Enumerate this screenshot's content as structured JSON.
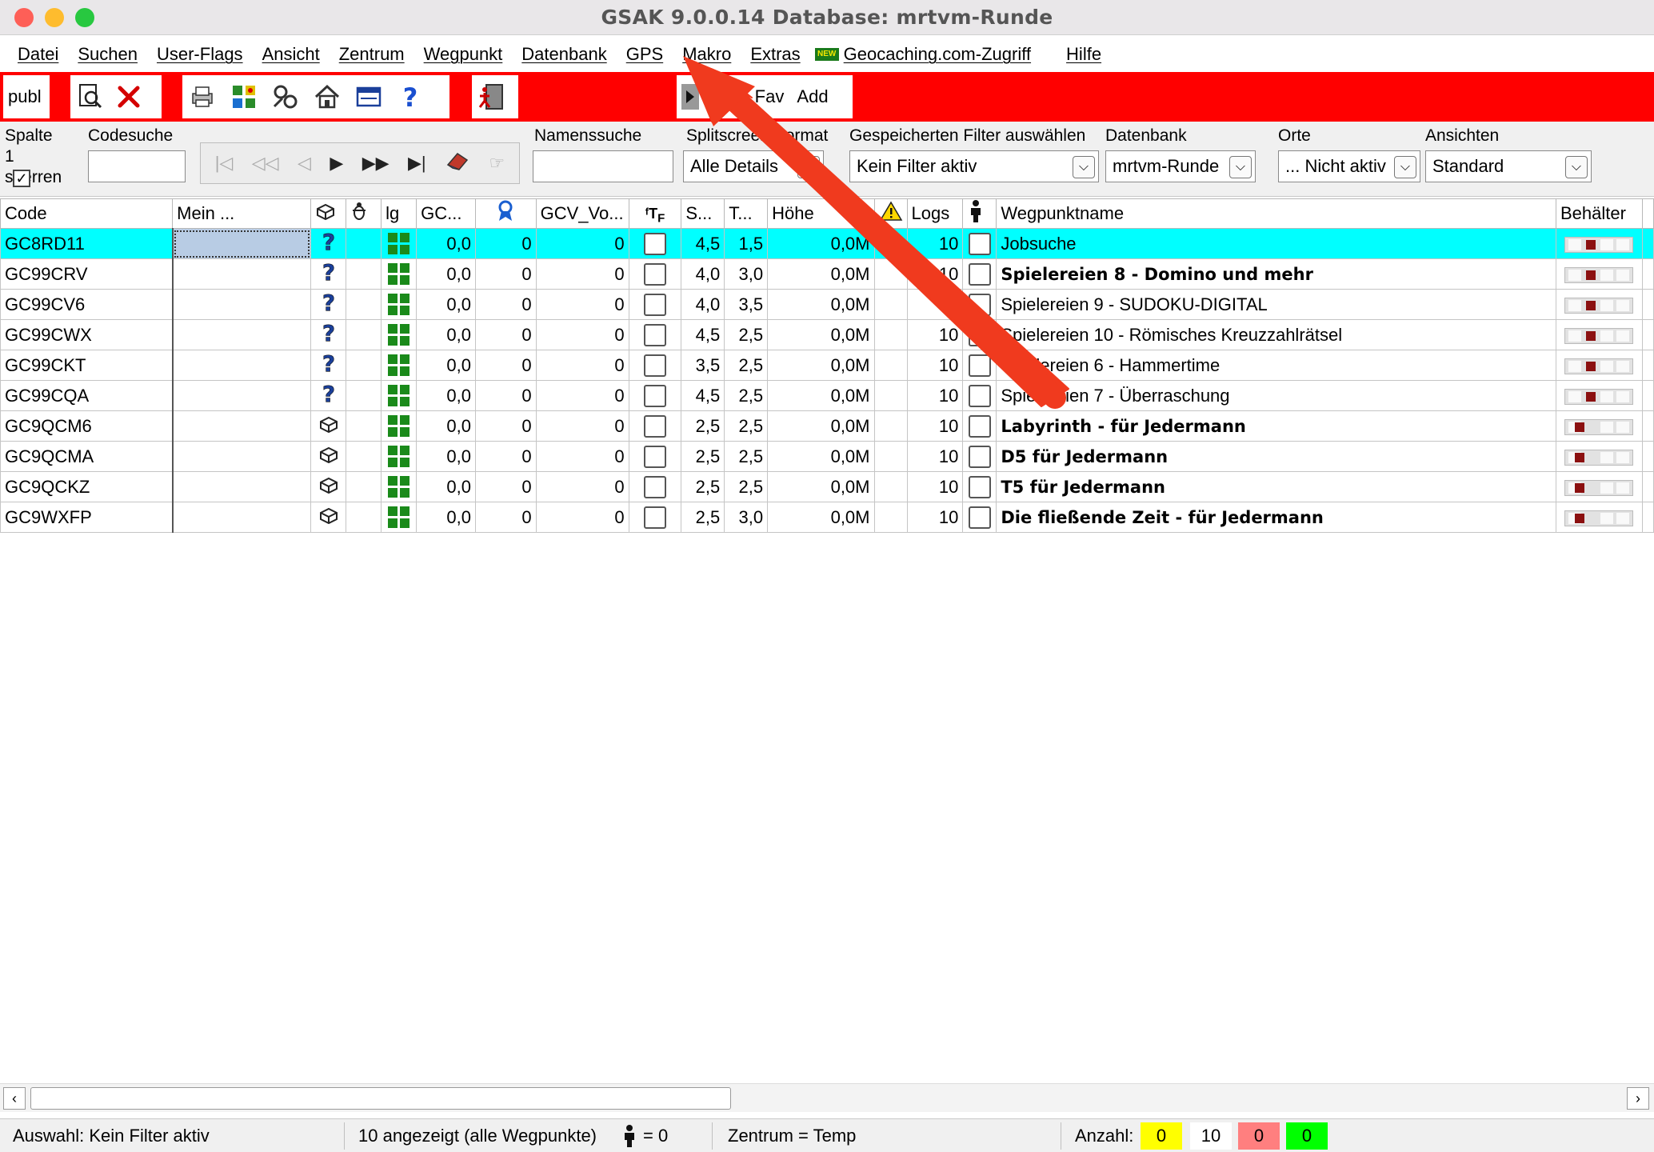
{
  "window": {
    "title": "GSAK 9.0.0.14    Database: mrtvm-Runde"
  },
  "menu": {
    "items": [
      "Datei",
      "Suchen",
      "User-Flags",
      "Ansicht",
      "Zentrum",
      "Wegpunkt",
      "Datenbank",
      "GPS",
      "Makro",
      "Extras"
    ],
    "new_badge": "NEW",
    "geocaching": "Geocaching.com-Zugriff",
    "help": "Hilfe"
  },
  "toolbar": {
    "publ_label": "publ",
    "macro_fi": "Fi",
    "macro_fav": "Fav",
    "macro_add": "Add"
  },
  "filters": {
    "spalte_label": "Spalte",
    "spalte_value": "1",
    "sperren_label": "sperren",
    "codesuche_label": "Codesuche",
    "codesuche_value": "",
    "namenssuche_label": "Namenssuche",
    "namenssuche_value": "",
    "splitscreen_label": "Splitscreen-Format",
    "splitscreen_value": "Alle Details",
    "filter_label": "Gespeicherten Filter auswählen",
    "filter_value": "Kein Filter aktiv",
    "datenbank_label": "Datenbank",
    "datenbank_value": "mrtvm-Runde",
    "orte_label": "Orte",
    "orte_value": "... Nicht aktiv",
    "ansichten_label": "Ansichten",
    "ansichten_value": "Standard"
  },
  "grid": {
    "headers": {
      "code": "Code",
      "mein": "Mein ...",
      "ig": "lg",
      "gc": "GC...",
      "gcv": "GCV_Vo...",
      "s": "S...",
      "t": "T...",
      "hoehe": "Höhe",
      "logs": "Logs",
      "name": "Wegpunktname",
      "behaelter": "Behälter"
    },
    "rows": [
      {
        "code": "GC8RD11",
        "type": "mystery",
        "gc": "0,0",
        "fav": "0",
        "gcv": "0",
        "s": "4,5",
        "t": "1,5",
        "hoehe": "0,0M",
        "logs": "10",
        "name": "Jobsuche",
        "bold": false,
        "selected": true
      },
      {
        "code": "GC99CRV",
        "type": "mystery",
        "gc": "0,0",
        "fav": "0",
        "gcv": "0",
        "s": "4,0",
        "t": "3,0",
        "hoehe": "0,0M",
        "logs": "10",
        "name": "Spielereien 8 - Domino und mehr",
        "bold": true,
        "selected": false
      },
      {
        "code": "GC99CV6",
        "type": "mystery",
        "gc": "0,0",
        "fav": "0",
        "gcv": "0",
        "s": "4,0",
        "t": "3,5",
        "hoehe": "0,0M",
        "logs": "10",
        "name": "Spielereien 9 - SUDOKU-DIGITAL",
        "bold": false,
        "selected": false
      },
      {
        "code": "GC99CWX",
        "type": "mystery",
        "gc": "0,0",
        "fav": "0",
        "gcv": "0",
        "s": "4,5",
        "t": "2,5",
        "hoehe": "0,0M",
        "logs": "10",
        "name": "Spielereien 10 - Römisches Kreuzzahlrätsel",
        "bold": false,
        "selected": false
      },
      {
        "code": "GC99CKT",
        "type": "mystery",
        "gc": "0,0",
        "fav": "0",
        "gcv": "0",
        "s": "3,5",
        "t": "2,5",
        "hoehe": "0,0M",
        "logs": "10",
        "name": "Spielereien 6 - Hammertime",
        "bold": false,
        "selected": false
      },
      {
        "code": "GC99CQA",
        "type": "mystery",
        "gc": "0,0",
        "fav": "0",
        "gcv": "0",
        "s": "4,5",
        "t": "2,5",
        "hoehe": "0,0M",
        "logs": "10",
        "name": "Spielereien 7 - Überraschung",
        "bold": false,
        "selected": false
      },
      {
        "code": "GC9QCM6",
        "type": "multi",
        "gc": "0,0",
        "fav": "0",
        "gcv": "0",
        "s": "2,5",
        "t": "2,5",
        "hoehe": "0,0M",
        "logs": "10",
        "name": "Labyrinth - für Jedermann",
        "bold": true,
        "selected": false
      },
      {
        "code": "GC9QCMA",
        "type": "multi",
        "gc": "0,0",
        "fav": "0",
        "gcv": "0",
        "s": "2,5",
        "t": "2,5",
        "hoehe": "0,0M",
        "logs": "10",
        "name": "D5 für Jedermann",
        "bold": true,
        "selected": false
      },
      {
        "code": "GC9QCKZ",
        "type": "multi",
        "gc": "0,0",
        "fav": "0",
        "gcv": "0",
        "s": "2,5",
        "t": "2,5",
        "hoehe": "0,0M",
        "logs": "10",
        "name": "T5 für Jedermann",
        "bold": true,
        "selected": false
      },
      {
        "code": "GC9WXFP",
        "type": "multi",
        "gc": "0,0",
        "fav": "0",
        "gcv": "0",
        "s": "2,5",
        "t": "3,0",
        "hoehe": "0,0M",
        "logs": "10",
        "name": "Die fließende Zeit - für Jedermann",
        "bold": true,
        "selected": false
      }
    ]
  },
  "status": {
    "auswahl": "Auswahl: Kein Filter aktiv",
    "angezeigt": "10 angezeigt (alle Wegpunkte)",
    "person_count": "= 0",
    "zentrum": "Zentrum = Temp",
    "anzahl_label": "Anzahl:",
    "count_yellow": "0",
    "count_total": "10",
    "count_red": "0",
    "count_green": "0"
  },
  "colors": {
    "toolbar_bg": "#ff0000",
    "selected_row": "#00ffff",
    "annotation_arrow": "#f03a1e"
  }
}
